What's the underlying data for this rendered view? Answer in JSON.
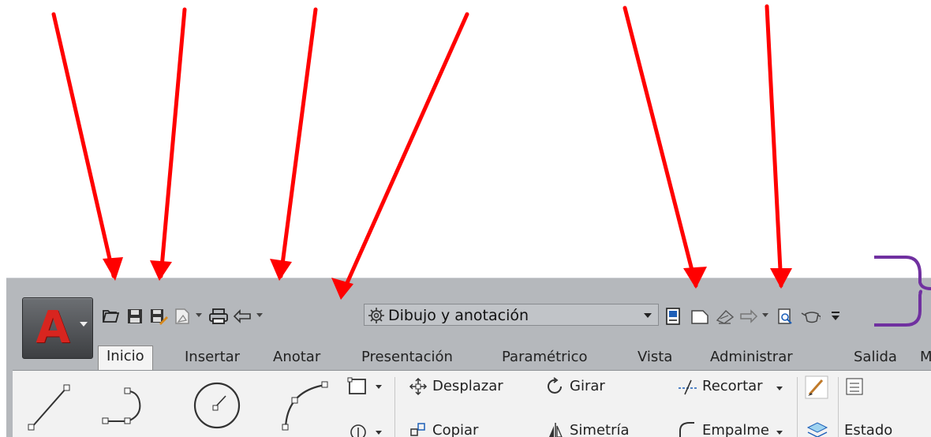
{
  "quick_access": {
    "workspace_label": "Dibujo y anotación",
    "icons": [
      "open-icon",
      "save-icon",
      "save-as-icon",
      "publish-icon",
      "print-icon",
      "undo-icon",
      "workspace-gear-icon",
      "properties-icon",
      "new-sheet-icon",
      "share-icon",
      "redo-icon",
      "preview-icon",
      "teapot-icon",
      "customize-icon"
    ]
  },
  "ribbon": {
    "tabs": [
      "Inicio",
      "Insertar",
      "Anotar",
      "Presentación",
      "Paramétrico",
      "Vista",
      "Administrar",
      "Salida",
      "M"
    ],
    "active_tab": "Inicio"
  },
  "panel": {
    "move_label": "Desplazar",
    "rotate_label": "Girar",
    "trim_label": "Recortar",
    "copy_label": "Copiar",
    "mirror_label": "Simetría",
    "fillet_label": "Empalme",
    "status_label": "Estado",
    "tools": [
      "line-icon",
      "polyline-icon",
      "circle-icon",
      "arc-icon",
      "rectangle-icon",
      "hatch-icon",
      "match-properties-icon",
      "layer-icon"
    ]
  },
  "annotation_colors": {
    "arrow": "#ff0000",
    "bracket": "#7030a0"
  }
}
